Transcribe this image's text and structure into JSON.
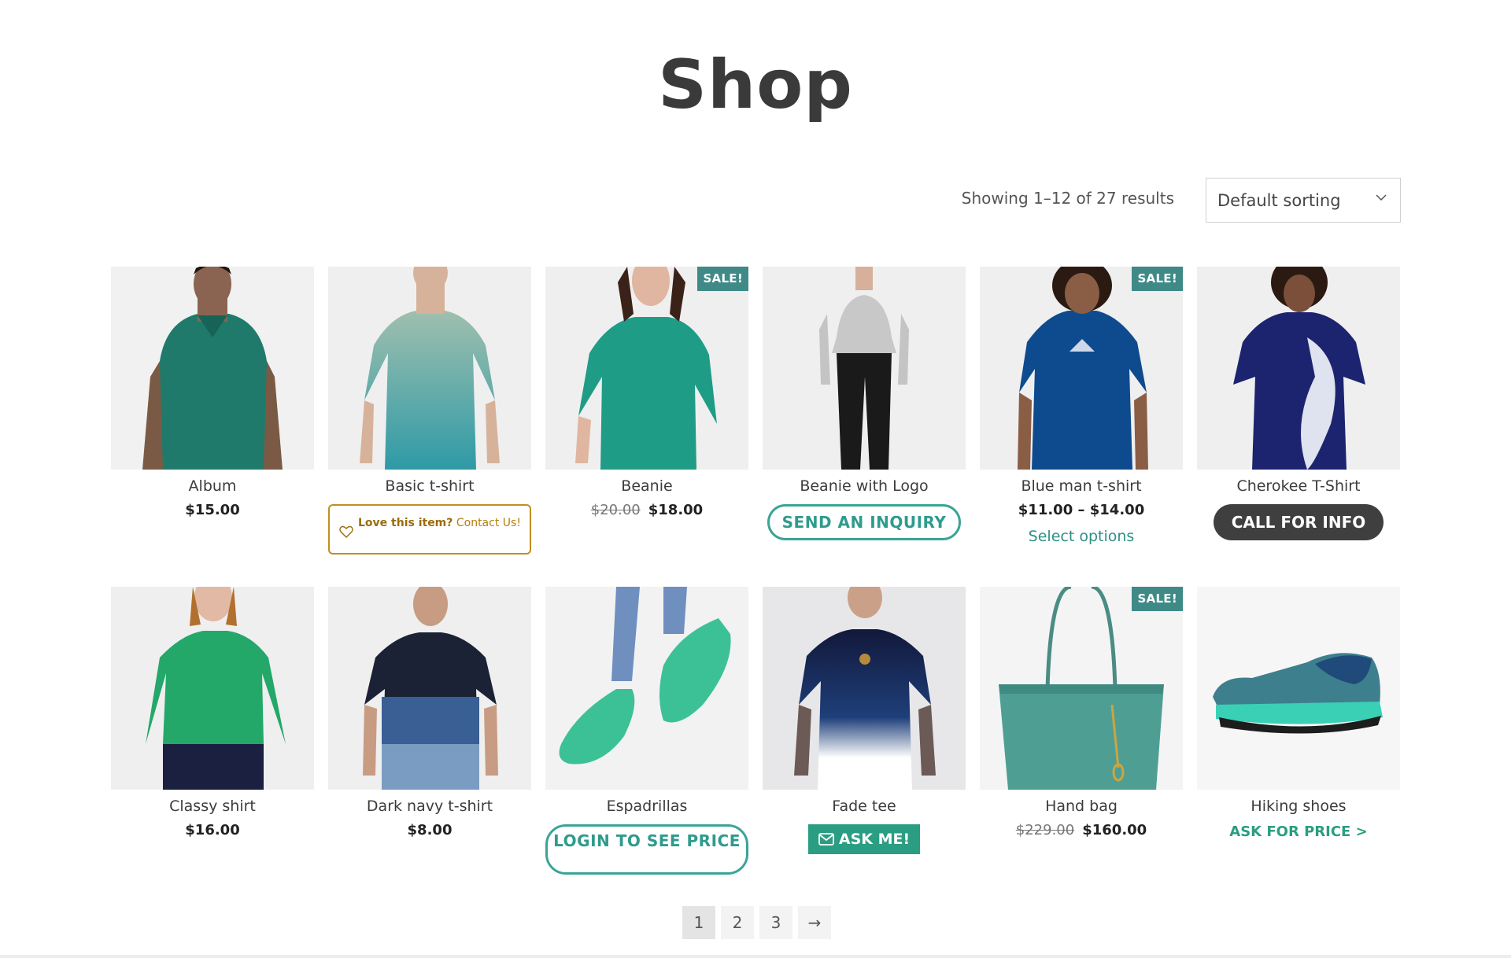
{
  "page": {
    "title": "Shop"
  },
  "toolbar": {
    "result_count": "Showing 1–12 of 27 results",
    "sorting": "Default sorting"
  },
  "colors": {
    "accent": "#3aa497",
    "sale_badge": "#3f8a87",
    "love_border": "#c28d1e",
    "dark_button": "#3f3f3f",
    "ask_button": "#2a9d82"
  },
  "products": [
    {
      "name": "Album",
      "price": "$15.00"
    },
    {
      "name": "Basic t-shirt",
      "love_bold": "Love this item?",
      "love_rest": " Contact Us!"
    },
    {
      "name": "Beanie",
      "sale": "SALE!",
      "old_price": "$20.00",
      "price": "$18.00"
    },
    {
      "name": "Beanie with Logo",
      "button": "SEND AN INQUIRY"
    },
    {
      "name": "Blue man t-shirt",
      "sale": "SALE!",
      "price": "$11.00 – $14.00",
      "link": "Select options"
    },
    {
      "name": "Cherokee T-Shirt",
      "button": "CALL FOR INFO"
    },
    {
      "name": "Classy shirt",
      "price": "$16.00"
    },
    {
      "name": "Dark navy t-shirt",
      "price": "$8.00"
    },
    {
      "name": "Espadrillas",
      "button": "LOGIN TO SEE PRICE"
    },
    {
      "name": "Fade tee",
      "button": "ASK ME!"
    },
    {
      "name": "Hand bag",
      "sale": "SALE!",
      "old_price": "$229.00",
      "price": "$160.00"
    },
    {
      "name": "Hiking shoes",
      "link": "ASK FOR PRICE >"
    }
  ],
  "pagination": {
    "pages": [
      "1",
      "2",
      "3"
    ],
    "next": "→",
    "current": "1"
  }
}
